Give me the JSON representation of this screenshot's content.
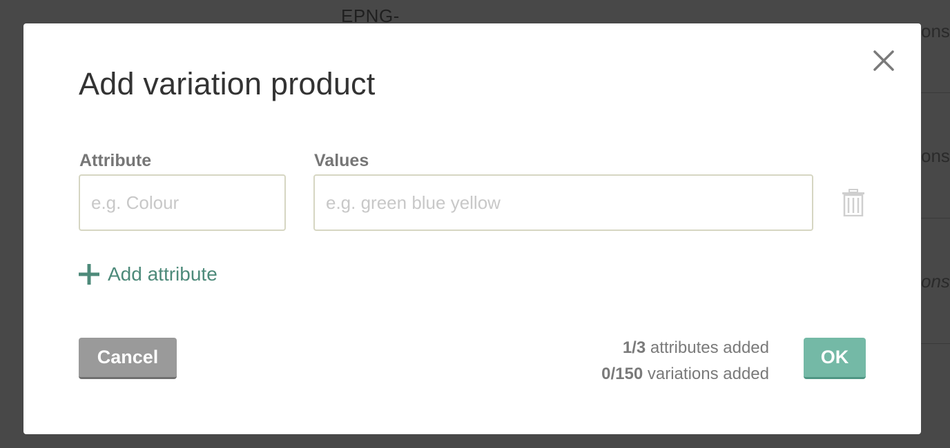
{
  "background": {
    "sku_fragment": "EPNG-",
    "right_column_fragments": [
      "ons",
      "ons",
      "ons"
    ]
  },
  "modal": {
    "title": "Add variation product",
    "attribute_label": "Attribute",
    "attribute_placeholder": "e.g. Colour",
    "attribute_value": "",
    "values_label": "Values",
    "values_placeholder": "e.g. green blue yellow",
    "values_value": "",
    "add_attribute_label": "Add attribute",
    "cancel_label": "Cancel",
    "ok_label": "OK",
    "attributes_count": "1/3",
    "attributes_suffix": "attributes added",
    "variations_count": "0/150",
    "variations_suffix": "variations added"
  },
  "icons": {
    "close": "close-icon",
    "trash": "trash-icon",
    "plus": "plus-icon"
  },
  "colors": {
    "accent": "#4d8a7a",
    "ok_button": "#74b9a6",
    "cancel_button": "#9a9a9a",
    "overlay": "#484848"
  }
}
